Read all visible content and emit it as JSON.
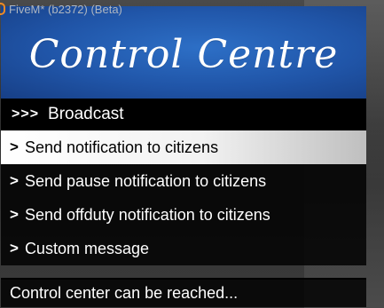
{
  "window": {
    "title": "FiveM* (b2372) (Beta)",
    "icon": "fivem-app-icon"
  },
  "menu": {
    "banner_title": "Control Centre",
    "subtitle_prefix": ">>>",
    "subtitle": "Broadcast",
    "chevron": ">",
    "selected_index": 0,
    "items": [
      {
        "label": "Send notification to citizens"
      },
      {
        "label": "Send pause notification to citizens"
      },
      {
        "label": "Send offduty notification to citizens"
      },
      {
        "label": "Custom message"
      }
    ],
    "description": "Control center can be reached..."
  },
  "colors": {
    "banner_blue": "#2055a8",
    "selected_bg": "#ffffff",
    "menu_bg": "#000000",
    "icon_orange": "#f08a24"
  }
}
